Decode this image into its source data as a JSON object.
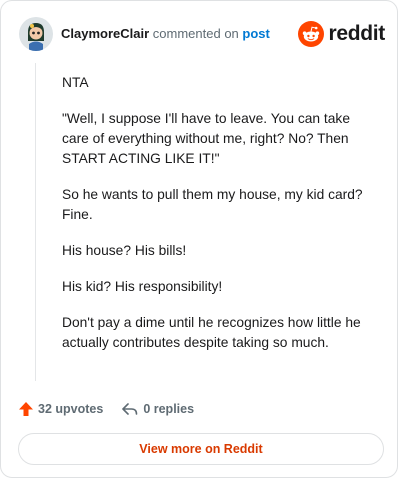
{
  "header": {
    "author": "ClaymoreClair",
    "action": "commented on",
    "post_link": "post",
    "logo_text": "reddit"
  },
  "comment": {
    "paragraphs": [
      "NTA",
      "\"Well, I suppose I'll have to leave. You can take care of everything without me, right? No? Then START ACTING LIKE IT!\"",
      "So he wants to pull them my house, my kid card? Fine.",
      "His house? His bills!",
      "His kid? His responsibility!",
      "Don't pay a dime until he recognizes how little he actually contributes despite taking so much."
    ]
  },
  "footer": {
    "upvotes": "32 upvotes",
    "replies": "0 replies"
  },
  "view_more": "View more on Reddit",
  "colors": {
    "brand": "#ff4500",
    "link": "#0079d3",
    "cta": "#d93a00",
    "muted": "#5f6b73"
  },
  "icons": [
    "avatar",
    "reddit-logo-icon",
    "upvote-icon",
    "reply-icon"
  ]
}
